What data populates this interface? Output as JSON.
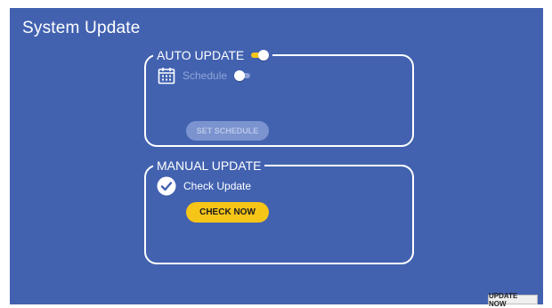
{
  "page": {
    "title": "System Update"
  },
  "auto_update": {
    "legend": "AUTO UPDATE",
    "toggle_on": true,
    "schedule_label": "Schedule",
    "schedule_toggle_on": false,
    "set_schedule_label": "SET SCHEDULE",
    "set_schedule_enabled": false,
    "calendar_icon": "calendar-icon"
  },
  "manual_update": {
    "legend": "MANUAL UPDATE",
    "check_label": "Check Update",
    "checked": true,
    "check_now_label": "CHECK NOW",
    "check_icon": "check-circle-icon"
  },
  "footer": {
    "update_now_label": "UPDATE NOW"
  },
  "colors": {
    "background": "#4262b0",
    "accent": "#f5c518",
    "disabled_button": "#7b93cf",
    "border": "#ffffff"
  }
}
